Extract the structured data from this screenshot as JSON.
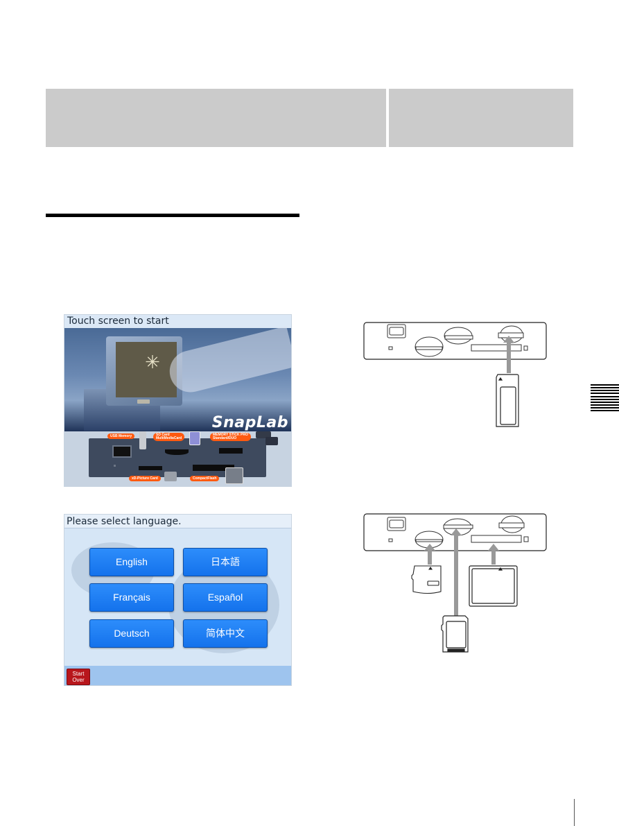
{
  "header": {
    "left_box_text": "",
    "right_box_text": ""
  },
  "screens": {
    "start_screen": {
      "title": "Touch screen to start",
      "logo": "SnapLab",
      "labels": {
        "usb": "USB Memory",
        "sd": "SD Card\nMultiMediaCard",
        "ms": "MEMORY STICK PRO\nStandard/DUO",
        "xd": "xD-Picture Card",
        "cf": "CompactFlash"
      }
    },
    "language_screen": {
      "title": "Please select language.",
      "buttons": [
        {
          "label": "English"
        },
        {
          "label": "日本語"
        },
        {
          "label": "Français"
        },
        {
          "label": "Español"
        },
        {
          "label": "Deutsch"
        },
        {
          "label": "简体中文"
        }
      ],
      "start_over": "Start Over"
    }
  },
  "diagrams": {
    "memory_stick_insertion": {
      "arrow_color": "#999999"
    },
    "multi_card_insertion": {
      "arrow_color": "#999999"
    }
  }
}
